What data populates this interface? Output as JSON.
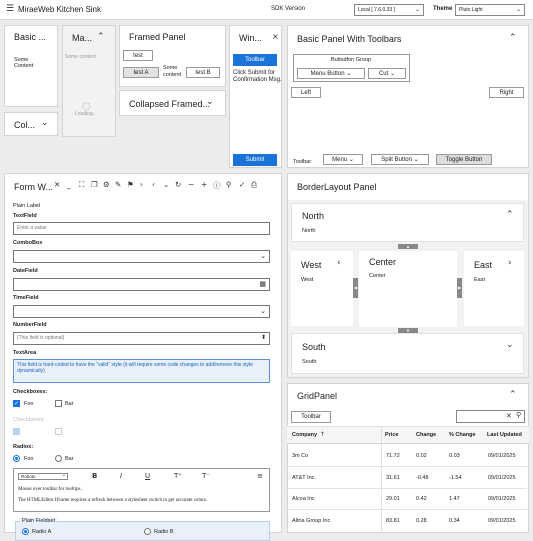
{
  "app": {
    "title": "MiraeWeb Kitchen Sink",
    "sdk_label": "SDK Version",
    "sdk_value": "Local [ 7.6.0.33 ]",
    "theme_label": "Theme",
    "theme_value": "Pluto Light"
  },
  "basic": {
    "title": "Basic ...",
    "content": "Some Content"
  },
  "collapsed": {
    "title": "Col..."
  },
  "masked": {
    "title": "Ma...",
    "content": "Some content",
    "loading": "Loading..."
  },
  "framed": {
    "title": "Framed Panel",
    "test": "test",
    "testA": "test A",
    "some_content": "Some content",
    "testB": "test B"
  },
  "collapsed_framed": {
    "title": "Collapsed Framed..."
  },
  "window": {
    "title": "Win...",
    "toolbar": "Toolbar",
    "message": "Click Submit for Confirmation Msg.",
    "submit": "Submit"
  },
  "toolbars": {
    "title": "Basic Panel With Toolbars",
    "group_title": "Buttsdfon Group",
    "menu_button": "Menu Button",
    "cut": "Cut",
    "left": "Left",
    "right": "Right",
    "toolbar_label": "Toolbar",
    "menu": "Menu",
    "split_button": "Split Button",
    "toggle_button": "Toggle Button"
  },
  "form": {
    "title": "Form W...",
    "plain_label": "Plain Label",
    "textfield_label": "TextField",
    "textfield_placeholder": "Enter a value",
    "combobox_label": "ComboBox",
    "datefield_label": "DateField",
    "timefield_label": "TimeField",
    "numberfield_label": "NumberField",
    "numberfield_placeholder": "(This field is optional)",
    "textarea_label": "TextArea",
    "textarea_value": "This field is hard-coded to have the \"valid\" style (it will require some code changes to add/remove this style dynamically)",
    "checkboxes_label": "Checkboxes:",
    "foo": "Foo",
    "bar": "Bar",
    "checkboxes_disabled_label": "Checkboxes:",
    "radios_label": "Radios:",
    "editor_font": "Roboto",
    "editor_line1": "Mouse over toolbar for tooltips.",
    "editor_line2": "The HTMLEditor IFrame requires a refresh between a stylesheet switch to get accurate colors.",
    "fieldset_title": "Plain Fieldset",
    "radio_a": "Radio A",
    "radio_b": "Radio B"
  },
  "border": {
    "title": "BorderLayout Panel",
    "north_title": "North",
    "north_content": "North",
    "west_title": "West",
    "west_content": "West",
    "center_title": "Center",
    "center_content": "Center",
    "east_title": "East",
    "east_content": "East",
    "south_title": "South",
    "south_content": "South"
  },
  "grid": {
    "title": "GridPanel",
    "toolbar": "Toolbar",
    "headers": [
      "Company",
      "Price",
      "Change",
      "% Change",
      "Last Updated"
    ],
    "rows": [
      [
        "3m Co",
        "71.72",
        "0.02",
        "0.03",
        "09/01/2025"
      ],
      [
        "AT&T Inc.",
        "31.61",
        "-0.48",
        "-1.54",
        "09/01/2025"
      ],
      [
        "Alcoa Inc",
        "29.01",
        "0.42",
        "1.47",
        "09/01/2025"
      ],
      [
        "Altria Group Inc",
        "83.81",
        "0.28",
        "0.34",
        "09/01/2025"
      ]
    ]
  }
}
